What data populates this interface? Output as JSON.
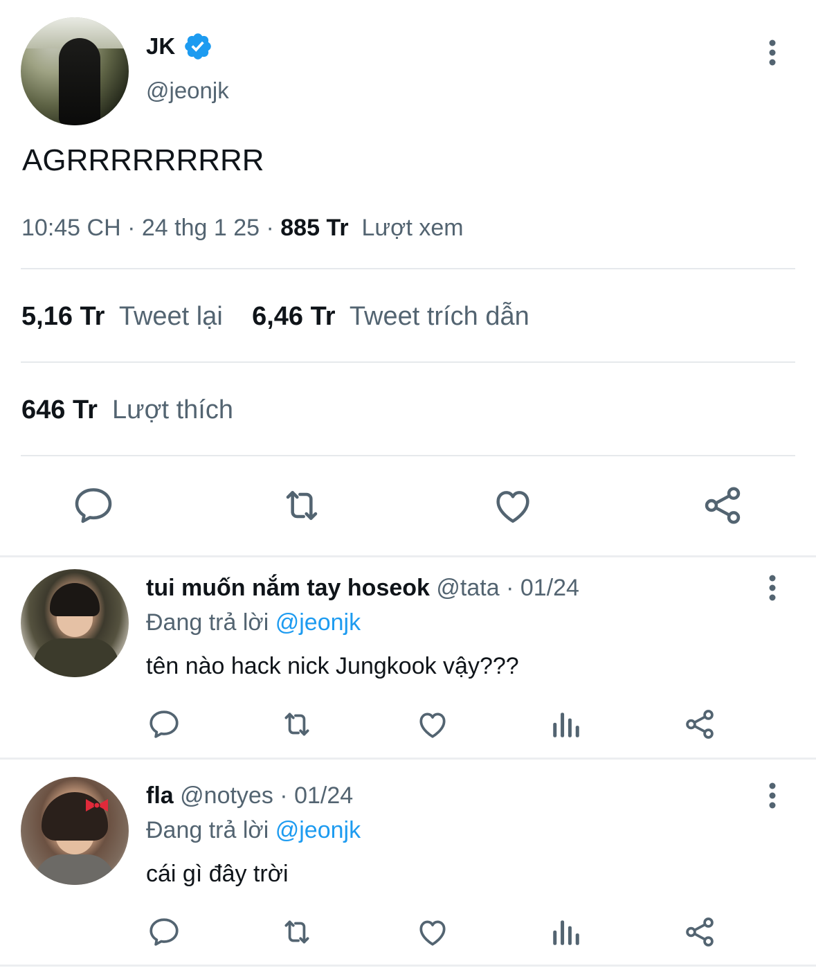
{
  "tweet": {
    "author_name": "JK",
    "author_handle": "@jeonjk",
    "text": "AGRRRRRRRRR",
    "time": "10:45 CH",
    "date": "24 thg 1 25",
    "views_count": "885 Tr",
    "views_label": "Lượt xem",
    "retweets_count": "5,16 Tr",
    "retweets_label": "Tweet lại",
    "quotes_count": "6,46 Tr",
    "quotes_label": "Tweet trích dẫn",
    "likes_count": "646 Tr",
    "likes_label": "Lượt thích",
    "sep": "·"
  },
  "replies": [
    {
      "name": "tui muốn nắm tay hoseok",
      "handle": "@tata",
      "date": "01/24",
      "replying_prefix": "Đang trả lời",
      "replying_to": "@jeonjk",
      "text": "tên nào hack nick Jungkook vậy???"
    },
    {
      "name": "fla",
      "handle": "@notyes",
      "date": "01/24",
      "replying_prefix": "Đang trả lời",
      "replying_to": "@jeonjk",
      "text": "cái gì đây trời"
    }
  ],
  "colors": {
    "accent": "#1d9bf0",
    "secondary_text": "#536471",
    "icon": "#536471",
    "divider": "#e6e9ec"
  },
  "icons": [
    "verified-badge-icon",
    "more-vertical-icon",
    "comment-icon",
    "retweet-icon",
    "like-icon",
    "views-icon",
    "share-icon"
  ]
}
